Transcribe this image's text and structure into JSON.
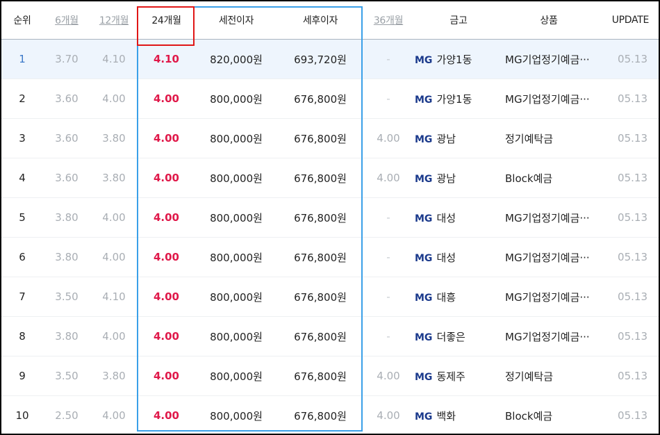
{
  "headers": {
    "rank": "순위",
    "m6": "6개월",
    "m12": "12개월",
    "m24": "24개월",
    "pretax": "세전이자",
    "aftertax": "세후이자",
    "m36": "36개월",
    "bank": "금고",
    "product": "상품",
    "update": "UPDATE"
  },
  "rows": [
    {
      "rank": "1",
      "m6": "3.70",
      "m12": "4.10",
      "m24": "4.10",
      "pretax": "820,000원",
      "aftertax": "693,720원",
      "m36": "-",
      "bank_prefix": "MG",
      "bank": "가양1동",
      "product": "MG기업정기예금···",
      "update": "05.13"
    },
    {
      "rank": "2",
      "m6": "3.60",
      "m12": "4.00",
      "m24": "4.00",
      "pretax": "800,000원",
      "aftertax": "676,800원",
      "m36": "-",
      "bank_prefix": "MG",
      "bank": "가양1동",
      "product": "MG기업정기예금···",
      "update": "05.13"
    },
    {
      "rank": "3",
      "m6": "3.60",
      "m12": "3.80",
      "m24": "4.00",
      "pretax": "800,000원",
      "aftertax": "676,800원",
      "m36": "4.00",
      "bank_prefix": "MG",
      "bank": "광남",
      "product": "정기예탁금",
      "update": "05.13"
    },
    {
      "rank": "4",
      "m6": "3.60",
      "m12": "3.80",
      "m24": "4.00",
      "pretax": "800,000원",
      "aftertax": "676,800원",
      "m36": "4.00",
      "bank_prefix": "MG",
      "bank": "광남",
      "product": "Block예금",
      "update": "05.13"
    },
    {
      "rank": "5",
      "m6": "3.80",
      "m12": "4.00",
      "m24": "4.00",
      "pretax": "800,000원",
      "aftertax": "676,800원",
      "m36": "-",
      "bank_prefix": "MG",
      "bank": "대성",
      "product": "MG기업정기예금···",
      "update": "05.13"
    },
    {
      "rank": "6",
      "m6": "3.80",
      "m12": "4.00",
      "m24": "4.00",
      "pretax": "800,000원",
      "aftertax": "676,800원",
      "m36": "-",
      "bank_prefix": "MG",
      "bank": "대성",
      "product": "MG기업정기예금···",
      "update": "05.13"
    },
    {
      "rank": "7",
      "m6": "3.50",
      "m12": "4.10",
      "m24": "4.00",
      "pretax": "800,000원",
      "aftertax": "676,800원",
      "m36": "-",
      "bank_prefix": "MG",
      "bank": "대흥",
      "product": "MG기업정기예금···",
      "update": "05.13"
    },
    {
      "rank": "8",
      "m6": "3.80",
      "m12": "4.00",
      "m24": "4.00",
      "pretax": "800,000원",
      "aftertax": "676,800원",
      "m36": "-",
      "bank_prefix": "MG",
      "bank": "더좋은",
      "product": "MG기업정기예금···",
      "update": "05.13"
    },
    {
      "rank": "9",
      "m6": "3.50",
      "m12": "3.80",
      "m24": "4.00",
      "pretax": "800,000원",
      "aftertax": "676,800원",
      "m36": "4.00",
      "bank_prefix": "MG",
      "bank": "동제주",
      "product": "정기예탁금",
      "update": "05.13"
    },
    {
      "rank": "10",
      "m6": "2.50",
      "m12": "4.00",
      "m24": "4.00",
      "pretax": "800,000원",
      "aftertax": "676,800원",
      "m36": "4.00",
      "bank_prefix": "MG",
      "bank": "백화",
      "product": "Block예금",
      "update": "05.13"
    }
  ],
  "colors": {
    "highlight_rate": "#e0194a",
    "blue_box": "#3aa0e8",
    "red_box": "#e01616",
    "first_row_bg": "#eef5fd"
  }
}
